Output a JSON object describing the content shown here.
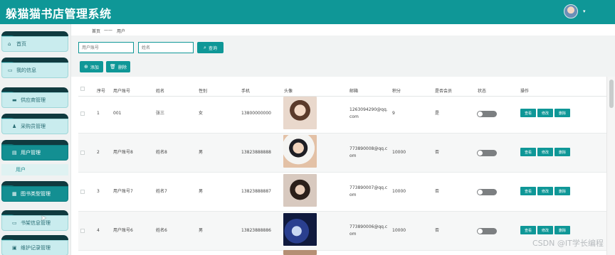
{
  "app": {
    "title": "躲猫猫书店管理系统"
  },
  "header": {
    "avatar_icon": "user-avatar",
    "caret": "▾"
  },
  "sidebar": {
    "items": [
      {
        "label": "首页",
        "icon": "home-icon",
        "glyph": "⌂"
      },
      {
        "label": "我的信息",
        "icon": "id-card-icon",
        "glyph": "▭"
      },
      {
        "label": "供应商管理",
        "icon": "card-icon",
        "glyph": "▬"
      },
      {
        "label": "采购员管理",
        "icon": "person-icon",
        "glyph": "♟"
      },
      {
        "label": "用户管理",
        "icon": "list-icon",
        "glyph": "▤"
      },
      {
        "label": "图书类型管理",
        "icon": "grid-icon",
        "glyph": "▦"
      },
      {
        "label": "书架信息管理",
        "icon": "monitor-icon",
        "glyph": "▭"
      },
      {
        "label": "维护记录管理",
        "icon": "chat-icon",
        "glyph": "▣"
      }
    ],
    "sub_item": "用户",
    "active_index": 4
  },
  "breadcrumb": {
    "home": "首页",
    "separator": "——",
    "current": "用户"
  },
  "filters": {
    "account_placeholder": "用户账号",
    "name_placeholder": "姓名",
    "search_label": "查询"
  },
  "actions": {
    "add_label": "添加",
    "delete_label": "删除"
  },
  "table": {
    "headers": [
      "序号",
      "用户账号",
      "姓名",
      "性别",
      "手机",
      "头像",
      "邮箱",
      "积分",
      "是否会员",
      "状态",
      "操作"
    ],
    "rows": [
      {
        "index": "1",
        "account": "001",
        "name": "张三",
        "gender": "女",
        "phone": "13800000000",
        "email": "1263094290@qq.com",
        "email_l1": "1263094290@qq.",
        "email_l2": "com",
        "points": "9",
        "member": "是",
        "status_on": false
      },
      {
        "index": "2",
        "account": "用户账号8",
        "name": "姓名8",
        "gender": "男",
        "phone": "13823888888",
        "email": "773890008@qq.com",
        "email_l1": "773890008@qq.c",
        "email_l2": "om",
        "points": "10000",
        "member": "否",
        "status_on": false
      },
      {
        "index": "3",
        "account": "用户账号7",
        "name": "姓名7",
        "gender": "男",
        "phone": "13823888887",
        "email": "773890007@qq.com",
        "email_l1": "773890007@qq.c",
        "email_l2": "om",
        "points": "10000",
        "member": "否",
        "status_on": false
      },
      {
        "index": "4",
        "account": "用户账号6",
        "name": "姓名6",
        "gender": "男",
        "phone": "13823888886",
        "email": "773890006@qq.com",
        "email_l1": "773890006@qq.c",
        "email_l2": "om",
        "points": "10000",
        "member": "否",
        "status_on": false
      }
    ],
    "row_buttons": {
      "view": "查看",
      "edit": "修改",
      "delete": "删除"
    }
  },
  "watermark": "CSDN @IT学长编程",
  "colors": {
    "primary": "#0f9797",
    "sidebar_item": "#c9ecee",
    "toggle_off": "#7c7f81"
  }
}
